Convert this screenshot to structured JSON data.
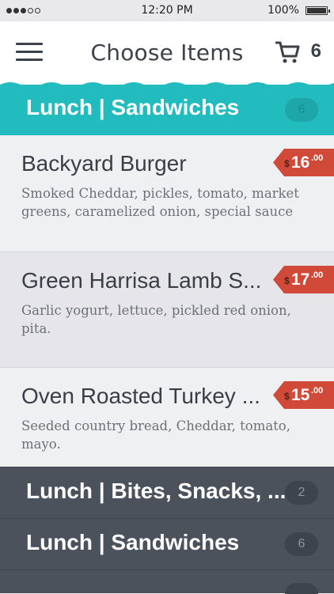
{
  "status_bar": {
    "time": "12:20 PM",
    "battery_text": "100%",
    "signal_filled": 3,
    "signal_total": 5
  },
  "header": {
    "title": "Choose Items",
    "cart_count": "6",
    "menu_icon": "hamburger-menu-icon",
    "cart_icon": "shopping-cart-icon"
  },
  "active_section": {
    "title": "Lunch | Sandwiches",
    "count": "6",
    "color": "#22bcbe"
  },
  "items": [
    {
      "name": "Backyard Burger",
      "description": "Smoked Cheddar, pickles, tomato, market greens, caramelized onion, special sauce",
      "price_currency": "$",
      "price_whole": "16",
      "price_cents": ".00"
    },
    {
      "name": "Green Harrisa Lamb S...",
      "description": "Garlic yogurt, lettuce, pickled red onion, pita.",
      "price_currency": "$",
      "price_whole": "17",
      "price_cents": ".00"
    },
    {
      "name": "Oven Roasted Turkey ...",
      "description": "Seeded country bread, Cheddar, tomato, mayo.",
      "price_currency": "$",
      "price_whole": "15",
      "price_cents": ".00"
    }
  ],
  "other_sections": [
    {
      "title": "Lunch | Bites, Snacks, ...",
      "count": "2"
    },
    {
      "title": "Lunch | Sandwiches",
      "count": "6"
    },
    {
      "title": "",
      "count": ""
    }
  ],
  "colors": {
    "price_tag": "#d14a39",
    "inactive_section": "#4b525c"
  }
}
